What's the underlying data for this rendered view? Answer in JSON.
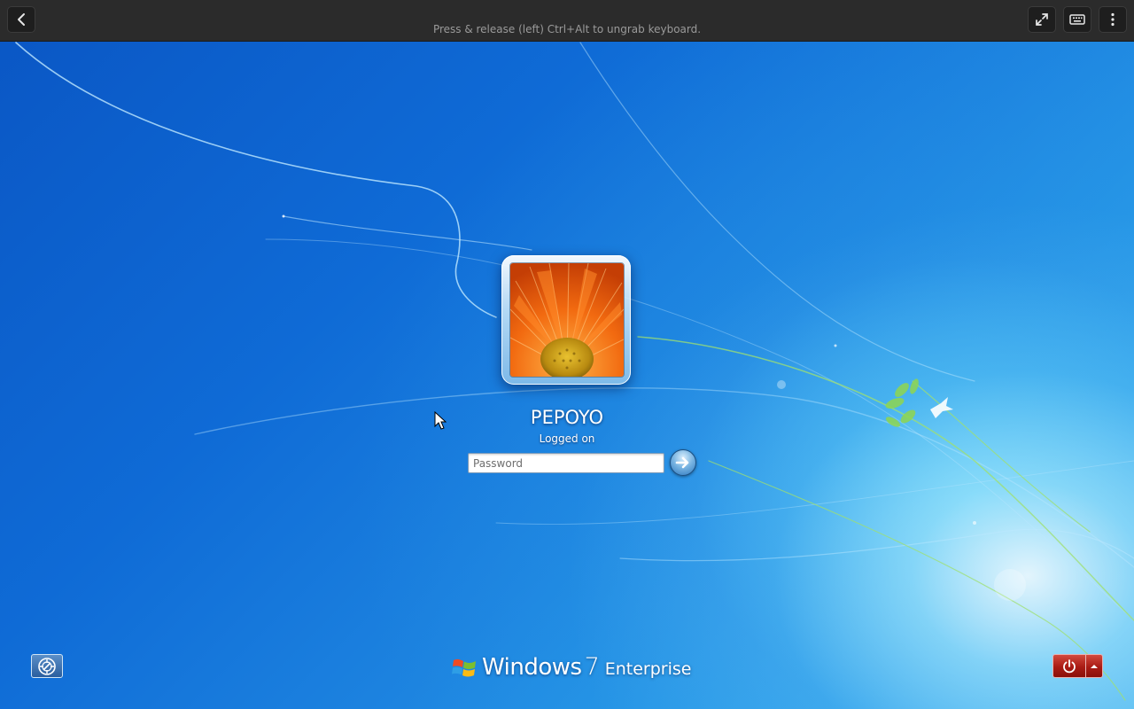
{
  "topbar": {
    "ungrab_hint": "Press & release (left) Ctrl+Alt to ungrab keyboard.",
    "back_icon": "chevron-left-icon",
    "fullscreen_icon": "expand-icon",
    "keyboard_icon": "keyboard-icon",
    "menu_icon": "kebab-menu-icon"
  },
  "login": {
    "username": "PEPOYO",
    "status": "Logged on",
    "password_placeholder": "Password",
    "submit_icon": "arrow-right-icon",
    "user_picture": "orange-gerbera-flower"
  },
  "bottom": {
    "ease_of_access_icon": "ease-of-access-icon",
    "brand_windows": "Windows",
    "brand_version": "7",
    "brand_edition": "Enterprise",
    "power_icon": "power-icon",
    "shutdown_options_icon": "triangle-up-icon"
  },
  "colors": {
    "topbar": "#2b2b2b",
    "wallpaper_blue": "#0f6bd6",
    "power_red": "#a91b14"
  }
}
